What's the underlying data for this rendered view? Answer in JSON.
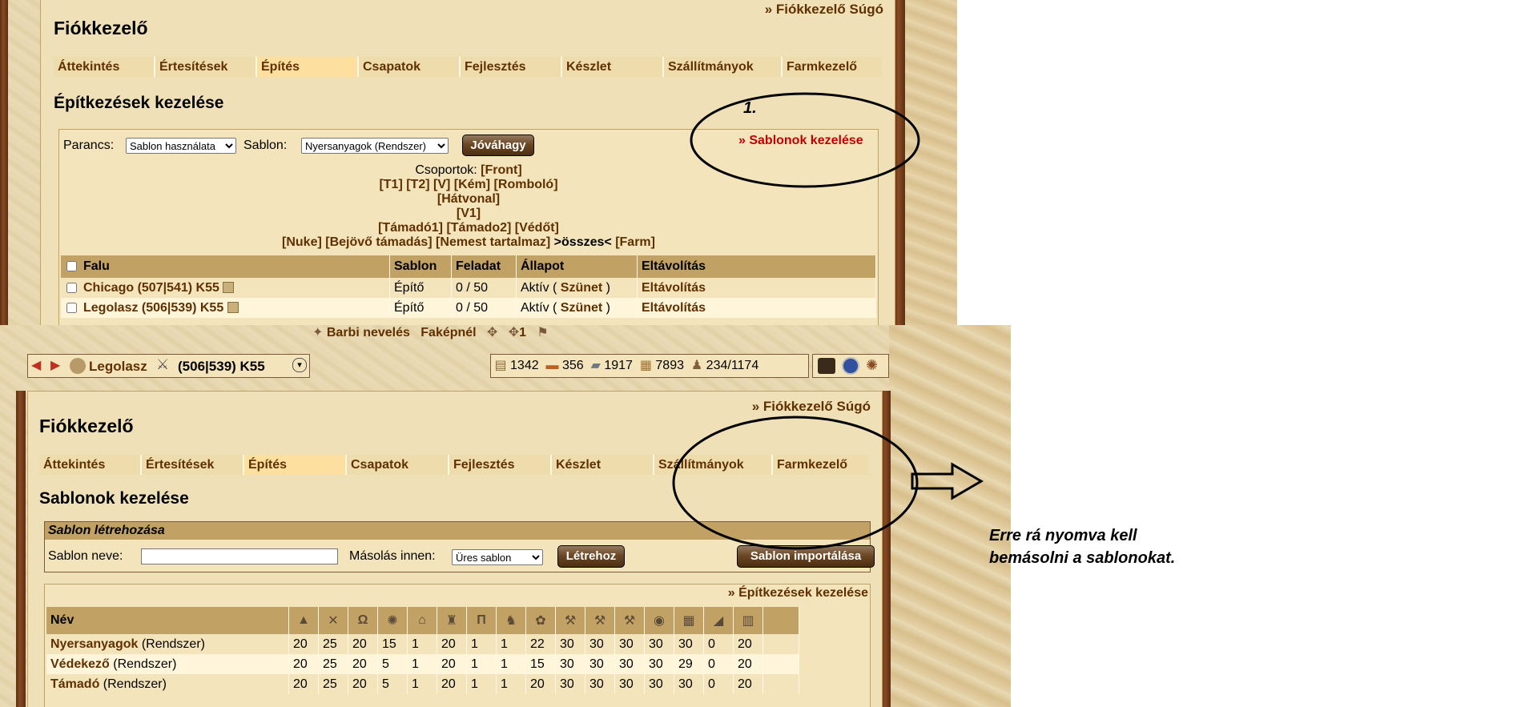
{
  "top": {
    "help_link": "» Fiókkezelő Súgó",
    "title": "Fiókkezelő",
    "tabs": [
      "Áttekintés",
      "Értesítések",
      "Építés",
      "Csapatok",
      "Fejlesztés",
      "Készlet",
      "Szállítmányok",
      "Farmkezelő"
    ],
    "active_tab": "Építés",
    "section_title": "Építkezések kezelése",
    "command_label": "Parancs:",
    "command_value": "Sablon használata",
    "template_label": "Sablon:",
    "template_value": "Nyersanyagok (Rendszer)",
    "confirm_button": "Jóváhagy",
    "manage_templates_link": "» Sablonok kezelése",
    "groups_label": "Csoportok:",
    "groups": {
      "line1": "[Front]",
      "line2": "[T1] [T2] [V] [Kém] [Romboló]",
      "line3": "[Hátvonal]",
      "line4": "[V1]",
      "line5": "[Támadó1] [Támado2] [Védőt]",
      "line6a": "[Nuke] [Bejövő támadás] [Nemest tartalmaz]",
      "line6b": ">összes<",
      "line6c": "[Farm]"
    },
    "table_headers": [
      "Falu",
      "Sablon",
      "Feladat",
      "Állapot",
      "Eltávolítás"
    ],
    "rows": [
      {
        "village": "Chicago (507|541) K55",
        "template": "Építő",
        "task": "0 / 50",
        "status_prefix": "Aktív ( ",
        "status_link": "Szünet",
        "status_suffix": " )",
        "remove": "Eltávolítás"
      },
      {
        "village": "Legolasz (506|539) K55",
        "template": "Építő",
        "task": "0 / 50",
        "status_prefix": "Aktív ( ",
        "status_link": "Szünet",
        "status_suffix": " )",
        "remove": "Eltávolítás"
      }
    ],
    "annotation_number": "1."
  },
  "bottom": {
    "crumb_links": [
      "Barbi nevelés",
      "Faképnél",
      "1"
    ],
    "village_name": "Legolasz",
    "village_coords": "(506|539) K55",
    "resources": {
      "wood": "1342",
      "clay": "356",
      "iron": "1917",
      "storage": "7893",
      "population": "234/1174"
    },
    "help_link": "» Fiókkezelő Súgó",
    "title": "Fiókkezelő",
    "tabs": [
      "Áttekintés",
      "Értesítések",
      "Építés",
      "Csapatok",
      "Fejlesztés",
      "Készlet",
      "Szállítmányok",
      "Farmkezelő"
    ],
    "active_tab": "Építés",
    "section_title": "Sablonok kezelése",
    "create_header": "Sablon létrehozása",
    "name_label": "Sablon neve:",
    "name_value": "",
    "copy_label": "Másolás innen:",
    "copy_value": "Üres sablon",
    "create_button": "Létrehoz",
    "import_button": "Sablon importálása",
    "manage_builds_link": "» Építkezések kezelése",
    "name_header": "Név",
    "building_icons": [
      "main-building-icon",
      "barracks-icon",
      "stable-icon",
      "workshop-icon",
      "academy-icon",
      "smithy-icon",
      "rally-point-icon",
      "statue-icon",
      "market-icon",
      "timber-camp-icon",
      "clay-pit-icon",
      "iron-mine-icon",
      "farm-icon",
      "warehouse-icon",
      "hiding-place-icon",
      "wall-icon"
    ],
    "templates": [
      {
        "name": "Nyersanyagok",
        "suffix": " (Rendszer)",
        "values": [
          "20",
          "25",
          "20",
          "15",
          "1",
          "20",
          "1",
          "1",
          "22",
          "30",
          "30",
          "30",
          "30",
          "30",
          "0",
          "20"
        ]
      },
      {
        "name": "Védekező",
        "suffix": " (Rendszer)",
        "values": [
          "20",
          "25",
          "20",
          "5",
          "1",
          "20",
          "1",
          "1",
          "15",
          "30",
          "30",
          "30",
          "30",
          "29",
          "0",
          "20"
        ]
      },
      {
        "name": "Támadó",
        "suffix": " (Rendszer)",
        "values": [
          "20",
          "25",
          "20",
          "5",
          "1",
          "20",
          "1",
          "1",
          "20",
          "30",
          "30",
          "30",
          "30",
          "30",
          "0",
          "20"
        ]
      }
    ]
  },
  "annotation_text_line1": "Erre rá nyomva kell",
  "annotation_text_line2": "bemásolni a sablonokat."
}
